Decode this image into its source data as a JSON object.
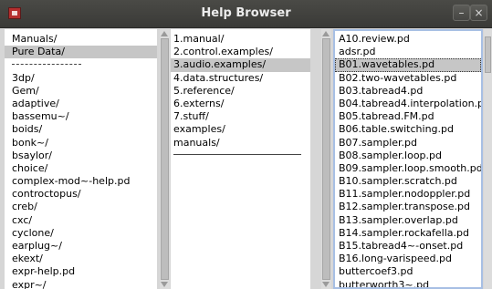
{
  "window": {
    "title": "Help Browser",
    "minimize_glyph": "–",
    "close_glyph": "×",
    "app_icon": "pd-app-icon",
    "icons": [
      "minimize-icon",
      "close-icon"
    ]
  },
  "column1": {
    "top_items": [
      "Manuals/",
      "Pure Data/"
    ],
    "selected": "Pure Data/",
    "items": [
      "3dp/",
      "Gem/",
      "adaptive/",
      "bassemu~/",
      "boids/",
      "bonk~/",
      "bsaylor/",
      "choice/",
      "complex-mod~-help.pd",
      "controctopus/",
      "creb/",
      "cxc/",
      "cyclone/",
      "earplug~/",
      "ekext/",
      "expr-help.pd",
      "expr~/"
    ]
  },
  "column2": {
    "items": [
      "1.manual/",
      "2.control.examples/",
      "3.audio.examples/",
      "4.data.structures/",
      "5.reference/",
      "6.externs/",
      "7.stuff/",
      "examples/",
      "manuals/"
    ],
    "selected": "3.audio.examples/"
  },
  "column3": {
    "items": [
      "A10.review.pd",
      "adsr.pd",
      "B01.wavetables.pd",
      "B02.two-wavetables.pd",
      "B03.tabread4.pd",
      "B04.tabread4.interpolation.pd",
      "B05.tabread.FM.pd",
      "B06.table.switching.pd",
      "B07.sampler.pd",
      "B08.sampler.loop.pd",
      "B09.sampler.loop.smooth.pd",
      "B10.sampler.scratch.pd",
      "B11.sampler.nodoppler.pd",
      "B12.sampler.transpose.pd",
      "B13.sampler.overlap.pd",
      "B14.sampler.rockafella.pd",
      "B15.tabread4~-onset.pd",
      "B16.long-varispeed.pd",
      "buttercoef3.pd",
      "butterworth3~.pd"
    ],
    "selected": "B01.wavetables.pd"
  }
}
